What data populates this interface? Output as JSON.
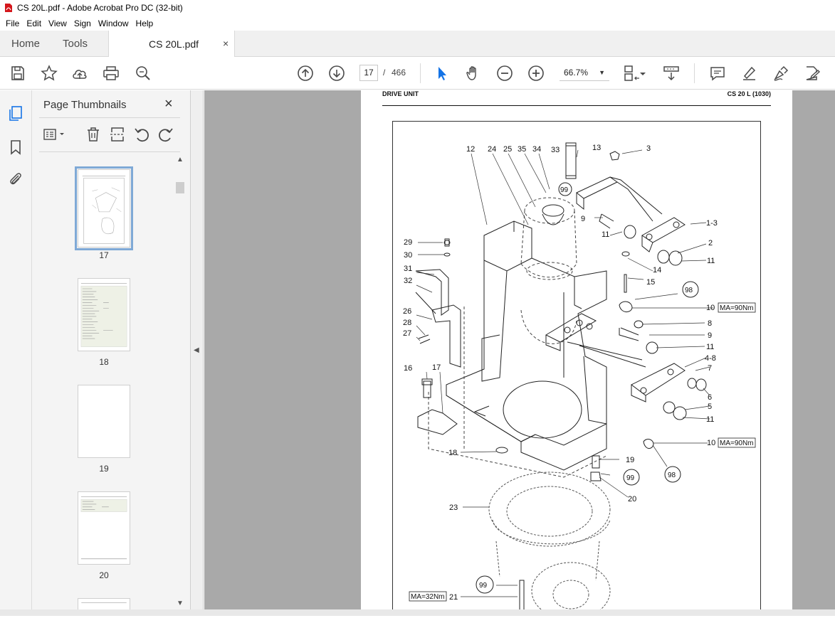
{
  "window": {
    "title": "CS 20L.pdf - Adobe Acrobat Pro DC (32-bit)"
  },
  "menu": [
    "File",
    "Edit",
    "View",
    "Sign",
    "Window",
    "Help"
  ],
  "tabs": {
    "home": "Home",
    "tools": "Tools",
    "document": "CS 20L.pdf",
    "close_glyph": "×"
  },
  "toolbar": {
    "current_page": "17",
    "separator": "/",
    "total_pages": "466",
    "zoom": "66.7%"
  },
  "thumbnails": {
    "title": "Page Thumbnails",
    "close_glyph": "×",
    "pages": [
      {
        "label": "17",
        "selected": true
      },
      {
        "label": "18",
        "selected": false
      },
      {
        "label": "19",
        "selected": false
      },
      {
        "label": "20",
        "selected": false
      }
    ]
  },
  "document": {
    "header_left": "DRIVE UNIT",
    "header_right": "CS 20 L (1030)",
    "callouts": {
      "c12": "12",
      "c24": "24",
      "c25": "25",
      "c35": "35",
      "c34": "34",
      "c33": "33",
      "c13": "13",
      "c3": "3",
      "c99a": "99",
      "c9a": "9",
      "c11a": "11",
      "c1_3": "1-3",
      "c2": "2",
      "c11b": "11",
      "c14": "14",
      "c15": "15",
      "c98a": "98",
      "c10a": "10",
      "c8": "8",
      "c9b": "9",
      "c11c": "11",
      "c4_8": "4-8",
      "c7": "7",
      "c6": "6",
      "c5": "5",
      "c11d": "11",
      "c10b": "10",
      "c19": "19",
      "c99b": "99",
      "c98b": "98",
      "c20": "20",
      "c29": "29",
      "c30": "30",
      "c31": "31",
      "c32": "32",
      "c26": "26",
      "c28": "28",
      "c27": "27",
      "c16": "16",
      "c17": "17",
      "c18": "18",
      "c23": "23",
      "c99c": "99",
      "c21": "21"
    },
    "torque_labels": {
      "ma1": "MA=90Nm",
      "ma2": "MA=90Nm",
      "ma3": "MA=32Nm"
    }
  },
  "colors": {
    "acrobat_red": "#d4161b",
    "selection_blue": "#7fa9d6",
    "doc_background": "#a9a9a9"
  }
}
